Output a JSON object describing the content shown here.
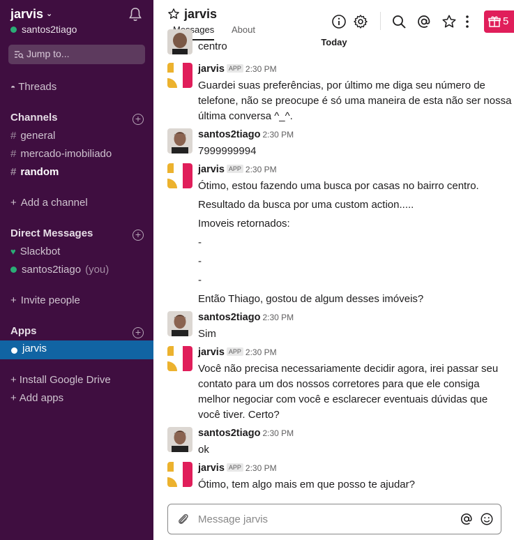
{
  "sidebar": {
    "team_name": "jarvis",
    "current_user": "santos2tiago",
    "jump_to": "Jump to...",
    "threads": "Threads",
    "channels_header": "Channels",
    "channels": [
      "general",
      "mercado-imobiliado",
      "random"
    ],
    "add_channel": "Add a channel",
    "dm_header": "Direct Messages",
    "dms": [
      "Slackbot",
      "santos2tiago"
    ],
    "you_tag": "(you)",
    "invite_people": "Invite people",
    "apps_header": "Apps",
    "apps": [
      "jarvis"
    ],
    "install_drive": "Install Google Drive",
    "add_apps": "Add apps"
  },
  "header": {
    "channel_title": "jarvis",
    "tabs": [
      "Messages",
      "About"
    ],
    "gift_count": "5",
    "date_divider": "Today"
  },
  "messages": [
    {
      "author": "",
      "badge": "",
      "time": "",
      "lines": [
        "centro"
      ]
    },
    {
      "author": "jarvis",
      "badge": "APP",
      "time": "2:30 PM",
      "lines": [
        "Guardei suas preferências, por último me diga seu número de",
        "telefone, não se preocupe é só uma maneira de esta não ser nossa",
        "última conversa ^_^."
      ]
    },
    {
      "author": "santos2tiago",
      "badge": "",
      "time": "2:30 PM",
      "lines": [
        "7999999994"
      ]
    },
    {
      "author": "jarvis",
      "badge": "APP",
      "time": "2:30 PM",
      "lines": [
        "Ótimo, estou fazendo uma busca por casas no bairro centro.",
        "Resultado da busca por uma custom action.....",
        "Imoveis retornados:",
        "-",
        "-",
        "-",
        "Então Thiago, gostou de algum desses imóveis?"
      ]
    },
    {
      "author": "santos2tiago",
      "badge": "",
      "time": "2:30 PM",
      "lines": [
        "Sim"
      ]
    },
    {
      "author": "jarvis",
      "badge": "APP",
      "time": "2:30 PM",
      "lines": [
        "Você não precisa necessariamente decidir agora, irei passar seu",
        "contato para um dos nossos corretores para que ele consiga",
        "melhor negociar com você e esclarecer eventuais dúvidas que",
        "você tiver. Certo?"
      ]
    },
    {
      "author": "santos2tiago",
      "badge": "",
      "time": "2:30 PM",
      "lines": [
        "ok"
      ]
    },
    {
      "author": "jarvis",
      "badge": "APP",
      "time": "2:30 PM",
      "lines": [
        "Ótimo, tem algo mais em que posso te ajudar?"
      ]
    }
  ],
  "composer": {
    "placeholder": "Message jarvis"
  },
  "colors": {
    "sidebar_bg": "#3f0e40",
    "active_item": "#1164a3",
    "presence_green": "#2bac76",
    "gift_red": "#e01e5a"
  }
}
